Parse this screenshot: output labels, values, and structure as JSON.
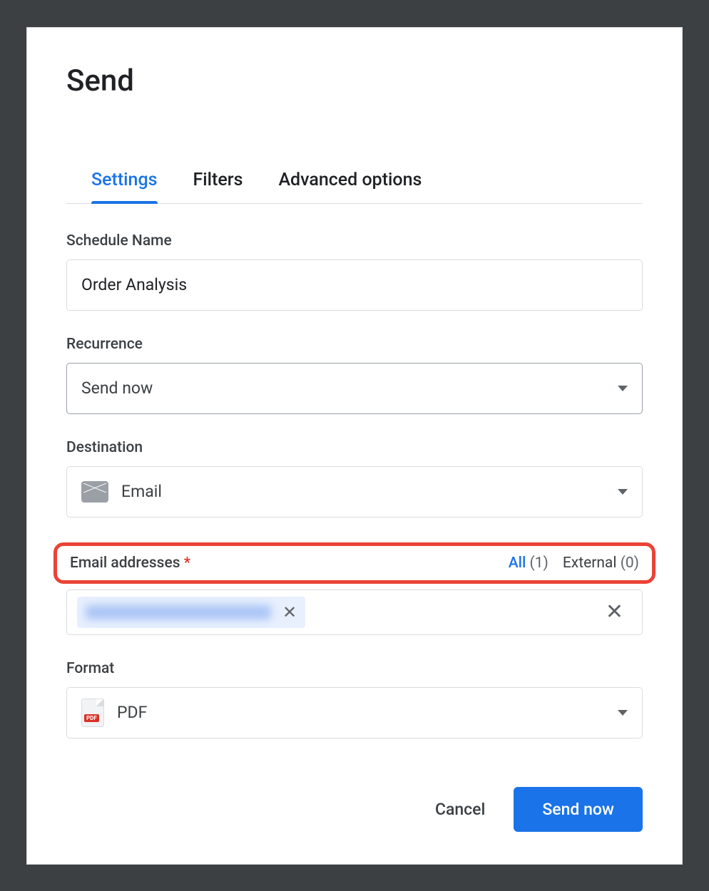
{
  "modal": {
    "title": "Send"
  },
  "tabs": {
    "settings": "Settings",
    "filters": "Filters",
    "advanced": "Advanced options"
  },
  "form": {
    "scheduleName": {
      "label": "Schedule Name",
      "value": "Order Analysis"
    },
    "recurrence": {
      "label": "Recurrence",
      "value": "Send now"
    },
    "destination": {
      "label": "Destination",
      "value": "Email"
    },
    "emailAddresses": {
      "label": "Email addresses",
      "requiredMark": "*",
      "filterAll": "All",
      "filterAllCount": "(1)",
      "filterExternal": "External",
      "filterExternalCount": "(0)"
    },
    "format": {
      "label": "Format",
      "value": "PDF"
    }
  },
  "footer": {
    "cancel": "Cancel",
    "submit": "Send now"
  }
}
